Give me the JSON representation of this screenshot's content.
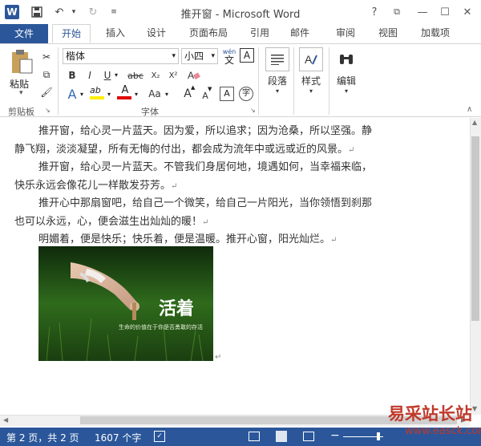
{
  "window": {
    "title": "推开窗 - Microsoft Word",
    "controls": [
      "?",
      "⧉",
      "—",
      "☐",
      "✕"
    ]
  },
  "tabs": [
    "文件",
    "开始",
    "插入",
    "设计",
    "页面布局",
    "引用",
    "邮件",
    "审阅",
    "视图",
    "加载项"
  ],
  "ribbon": {
    "clipboard": {
      "paste": "粘贴",
      "group_label": "剪贴板"
    },
    "font": {
      "family": "楷体",
      "size": "小四",
      "wen_top": "wén",
      "wen_bottom": "文",
      "boxed_a": "A",
      "bold": "B",
      "italic": "I",
      "underline": "U",
      "strike": "abc",
      "sub": "X₂",
      "sup": "X²",
      "highlight": "ab",
      "aa": "Aa",
      "grow": "A",
      "shrink": "A",
      "circled": "字",
      "group_label": "字体"
    },
    "paragraph": "段落",
    "styles": "样式",
    "editing": "编辑"
  },
  "document": {
    "lines": [
      "推开窗，给心灵一片蓝天。因为爱，所以追求；因为沧桑，所以坚强。静",
      "静飞翔，淡淡凝望，所有无悔的付出，都会成为流年中或远或近的风景。",
      "推开窗，给心灵一片蓝天。不管我们身居何地，境遇如何，当幸福来临，",
      "快乐永远会像花儿一样散发芬芳。",
      "推开心中那扇窗吧，给自己一个微笑，给自己一片阳光，当你领悟到刹那",
      "也可以永远，心，便会滋生出灿灿的暖！",
      "明媚着，便是快乐；快乐着，便是温暖。推开心窗，阳光灿烂。"
    ],
    "photo": {
      "title": "活着",
      "caption": "生命的价值在于你是否勇敢的存活"
    }
  },
  "status": {
    "page": "第 2 页，共 2 页",
    "words": "1607 个字"
  },
  "watermark": {
    "main": "易采站长站",
    "sub": "www.easck.com"
  }
}
